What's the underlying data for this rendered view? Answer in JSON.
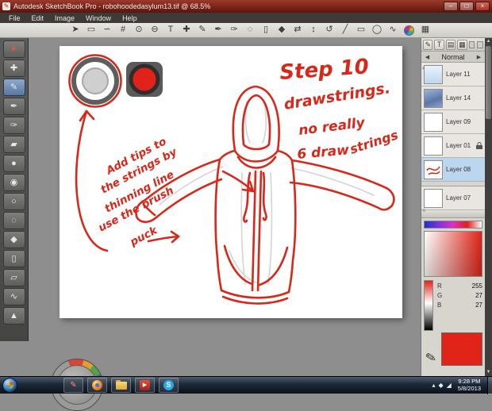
{
  "window": {
    "app_glyph": "✎",
    "title": "Autodesk SketchBook Pro - robohoodedasylum13.tif @ 68.5%",
    "minimize": "–",
    "maximize": "□",
    "close": "×"
  },
  "menu": {
    "items": [
      {
        "label": "File"
      },
      {
        "label": "Edit"
      },
      {
        "label": "Image"
      },
      {
        "label": "Window"
      },
      {
        "label": "Help"
      }
    ]
  },
  "toolbar": {
    "tools": [
      {
        "name": "select-tool",
        "glyph": "➤"
      },
      {
        "name": "marquee-select-tool",
        "glyph": "▭"
      },
      {
        "name": "lasso-tool",
        "glyph": "∽"
      },
      {
        "name": "crop-tool",
        "glyph": "#"
      },
      {
        "name": "zoom-in-tool",
        "glyph": "⊙"
      },
      {
        "name": "zoom-out-tool",
        "glyph": "⊖"
      },
      {
        "name": "text-tool",
        "glyph": "T"
      },
      {
        "name": "move-tool",
        "glyph": "✚"
      },
      {
        "name": "pencil-tool",
        "glyph": "✎"
      },
      {
        "name": "pen-tool",
        "glyph": "✒"
      },
      {
        "name": "marker-tool",
        "glyph": "✑"
      },
      {
        "name": "airbrush-tool",
        "glyph": "◌"
      },
      {
        "name": "eraser-tool",
        "glyph": "▯"
      },
      {
        "name": "fill-tool",
        "glyph": "◆"
      },
      {
        "name": "symmetry-x-tool",
        "glyph": "⇄"
      },
      {
        "name": "symmetry-y-tool",
        "glyph": "↕"
      },
      {
        "name": "transform-tool",
        "glyph": "↺"
      },
      {
        "name": "line-tool",
        "glyph": "╱"
      },
      {
        "name": "rectangle-tool",
        "glyph": "▭"
      },
      {
        "name": "ellipse-tool",
        "glyph": "◯"
      },
      {
        "name": "curve-tool",
        "glyph": "∿"
      },
      {
        "name": "brush-library",
        "glyph": "▦"
      }
    ]
  },
  "left_palette": {
    "tools": [
      {
        "name": "select",
        "glyph": "➤"
      },
      {
        "name": "move",
        "glyph": "✚"
      },
      {
        "name": "pencil",
        "glyph": "✎"
      },
      {
        "name": "ballpoint-pen",
        "glyph": "✒"
      },
      {
        "name": "marker",
        "glyph": "✑"
      },
      {
        "name": "chisel-tip",
        "glyph": "▰"
      },
      {
        "name": "brush-large",
        "glyph": "●"
      },
      {
        "name": "brush-medium",
        "glyph": "◉"
      },
      {
        "name": "brush-small",
        "glyph": "○"
      },
      {
        "name": "airbrush",
        "glyph": "◌"
      },
      {
        "name": "flood-fill",
        "glyph": "◆"
      },
      {
        "name": "eraser-hard",
        "glyph": "▯"
      },
      {
        "name": "eraser-soft",
        "glyph": "▱"
      },
      {
        "name": "smear",
        "glyph": "∿"
      },
      {
        "name": "custom-brush",
        "glyph": "▲"
      }
    ]
  },
  "canvas": {
    "ink_color": "#d8281a",
    "annotations": {
      "step_title": "Step 10",
      "drawstrings": "drawstrings.",
      "no_really": "no really",
      "and_draw": "6 draw",
      "strings": "strings",
      "tip1": "Add tips to",
      "tip2": "the strings by",
      "tip3": "thinning line",
      "tip4": "use the brush",
      "tip5": "puck"
    }
  },
  "layers_panel": {
    "header_icons": [
      {
        "name": "brush-palette",
        "glyph": "✎"
      },
      {
        "name": "text-editor",
        "glyph": "T"
      },
      {
        "name": "layer-editor",
        "glyph": "▤"
      },
      {
        "name": "swatches",
        "glyph": "▦"
      }
    ],
    "collapse_glyph": "«",
    "blend": {
      "prev": "◀",
      "label": "Normal",
      "next": "▶"
    },
    "layers": [
      {
        "name": "Layer 11"
      },
      {
        "name": "Layer 14"
      },
      {
        "name": "Layer 09"
      },
      {
        "name": "Layer 01",
        "locked": true
      },
      {
        "name": "Layer 08",
        "selected": true
      },
      {
        "name": "Layer 07"
      }
    ]
  },
  "color_panel": {
    "r_label": "R",
    "r_value": "255",
    "g_label": "G",
    "g_value": "27",
    "b_label": "B",
    "b_value": "27",
    "current_color": "#e02417"
  },
  "scrollbar": {
    "up_glyph": "▲",
    "down_glyph": "▼"
  },
  "taskbar": {
    "apps": [
      {
        "name": "sketchbook",
        "glyph": "✎"
      },
      {
        "name": "firefox",
        "glyph": ""
      },
      {
        "name": "explorer",
        "glyph": ""
      },
      {
        "name": "media-player",
        "glyph": "▶"
      },
      {
        "name": "skype",
        "glyph": "S"
      }
    ],
    "tray": {
      "expand": "▴",
      "action_center": "◆",
      "network": "◢"
    },
    "clock": {
      "time": "9:28 PM",
      "date": "5/8/2013"
    }
  }
}
